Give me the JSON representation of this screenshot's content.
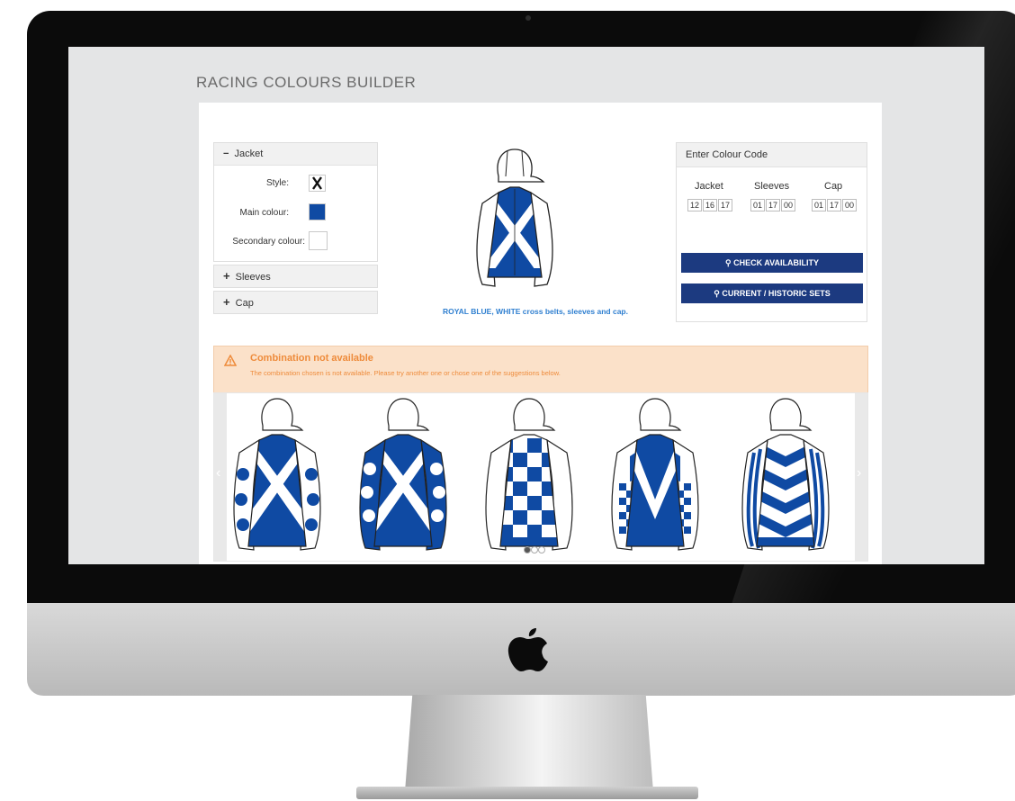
{
  "page": {
    "title": "RACING COLOURS BUILDER"
  },
  "jacket_panel": {
    "header": "Jacket",
    "toggle_symbol": "−",
    "style_label": "Style:",
    "main_colour_label": "Main colour:",
    "secondary_colour_label": "Secondary colour:",
    "main_colour": "#0f4aa3",
    "secondary_colour": "#ffffff"
  },
  "sleeves_panel": {
    "header": "Sleeves",
    "toggle_symbol": "+"
  },
  "cap_panel": {
    "header": "Cap",
    "toggle_symbol": "+"
  },
  "preview": {
    "description": "ROYAL BLUE, WHITE cross belts, sleeves and cap."
  },
  "colour_code": {
    "header": "Enter Colour Code",
    "jacket_label": "Jacket",
    "sleeves_label": "Sleeves",
    "cap_label": "Cap",
    "jacket_codes": [
      "12",
      "16",
      "17"
    ],
    "sleeves_codes": [
      "01",
      "17",
      "00"
    ],
    "cap_codes": [
      "01",
      "17",
      "00"
    ],
    "check_button": "CHECK AVAILABILITY",
    "historic_button": "CURRENT / HISTORIC SETS"
  },
  "alert": {
    "title": "Combination not available",
    "message": "The combination chosen is not available. Please try another one or chose one of the suggestions below."
  },
  "suggestions": [
    {
      "pattern": "cross-belts-spotted-sleeves"
    },
    {
      "pattern": "cross-belts-large-spots-sleeves"
    },
    {
      "pattern": "check-body-white-sleeves"
    },
    {
      "pattern": "chevron-check-sleeves"
    },
    {
      "pattern": "hoops-striped-sleeves"
    }
  ],
  "carousel": {
    "active_page": 1,
    "total_pages": 3
  },
  "colors": {
    "royal_blue": "#0f4aa3",
    "button_navy": "#1c3a80",
    "alert_orange": "#ee8b3b"
  }
}
